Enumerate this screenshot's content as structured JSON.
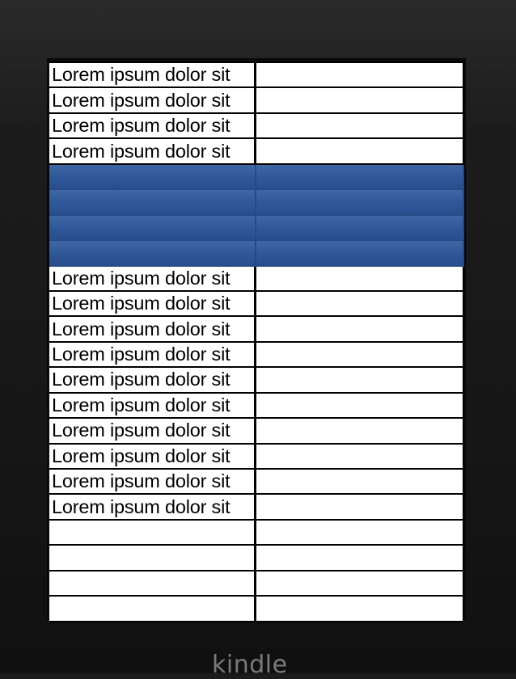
{
  "device": {
    "brand_logo": "kindle"
  },
  "table": {
    "rows": [
      {
        "col1": "Lorem ipsum dolor sit",
        "col2": "",
        "selected": false
      },
      {
        "col1": "Lorem ipsum dolor sit",
        "col2": "",
        "selected": false
      },
      {
        "col1": "Lorem ipsum dolor sit",
        "col2": "",
        "selected": false
      },
      {
        "col1": "Lorem ipsum dolor sit",
        "col2": "",
        "selected": false
      },
      {
        "col1": "",
        "col2": "",
        "selected": true
      },
      {
        "col1": "",
        "col2": "",
        "selected": true
      },
      {
        "col1": "",
        "col2": "",
        "selected": true
      },
      {
        "col1": "",
        "col2": "",
        "selected": true
      },
      {
        "col1": "Lorem ipsum dolor sit",
        "col2": "",
        "selected": false
      },
      {
        "col1": "Lorem ipsum dolor sit",
        "col2": "",
        "selected": false
      },
      {
        "col1": "Lorem ipsum dolor sit",
        "col2": "",
        "selected": false
      },
      {
        "col1": "Lorem ipsum dolor sit",
        "col2": "",
        "selected": false
      },
      {
        "col1": "Lorem ipsum dolor sit",
        "col2": "",
        "selected": false
      },
      {
        "col1": "Lorem ipsum dolor sit",
        "col2": "",
        "selected": false
      },
      {
        "col1": "Lorem ipsum dolor sit",
        "col2": "",
        "selected": false
      },
      {
        "col1": "Lorem ipsum dolor sit",
        "col2": "",
        "selected": false
      },
      {
        "col1": "Lorem ipsum dolor sit",
        "col2": "",
        "selected": false
      },
      {
        "col1": "Lorem ipsum dolor sit",
        "col2": "",
        "selected": false
      },
      {
        "col1": "",
        "col2": "",
        "selected": false
      },
      {
        "col1": "",
        "col2": "",
        "selected": false
      },
      {
        "col1": "",
        "col2": "",
        "selected": false
      },
      {
        "col1": "",
        "col2": "",
        "selected": false
      }
    ]
  },
  "colors": {
    "selection": "#2f5798",
    "grid": "#000000",
    "bezel": "#1b1b1b",
    "logo": "#7a7a7a"
  }
}
